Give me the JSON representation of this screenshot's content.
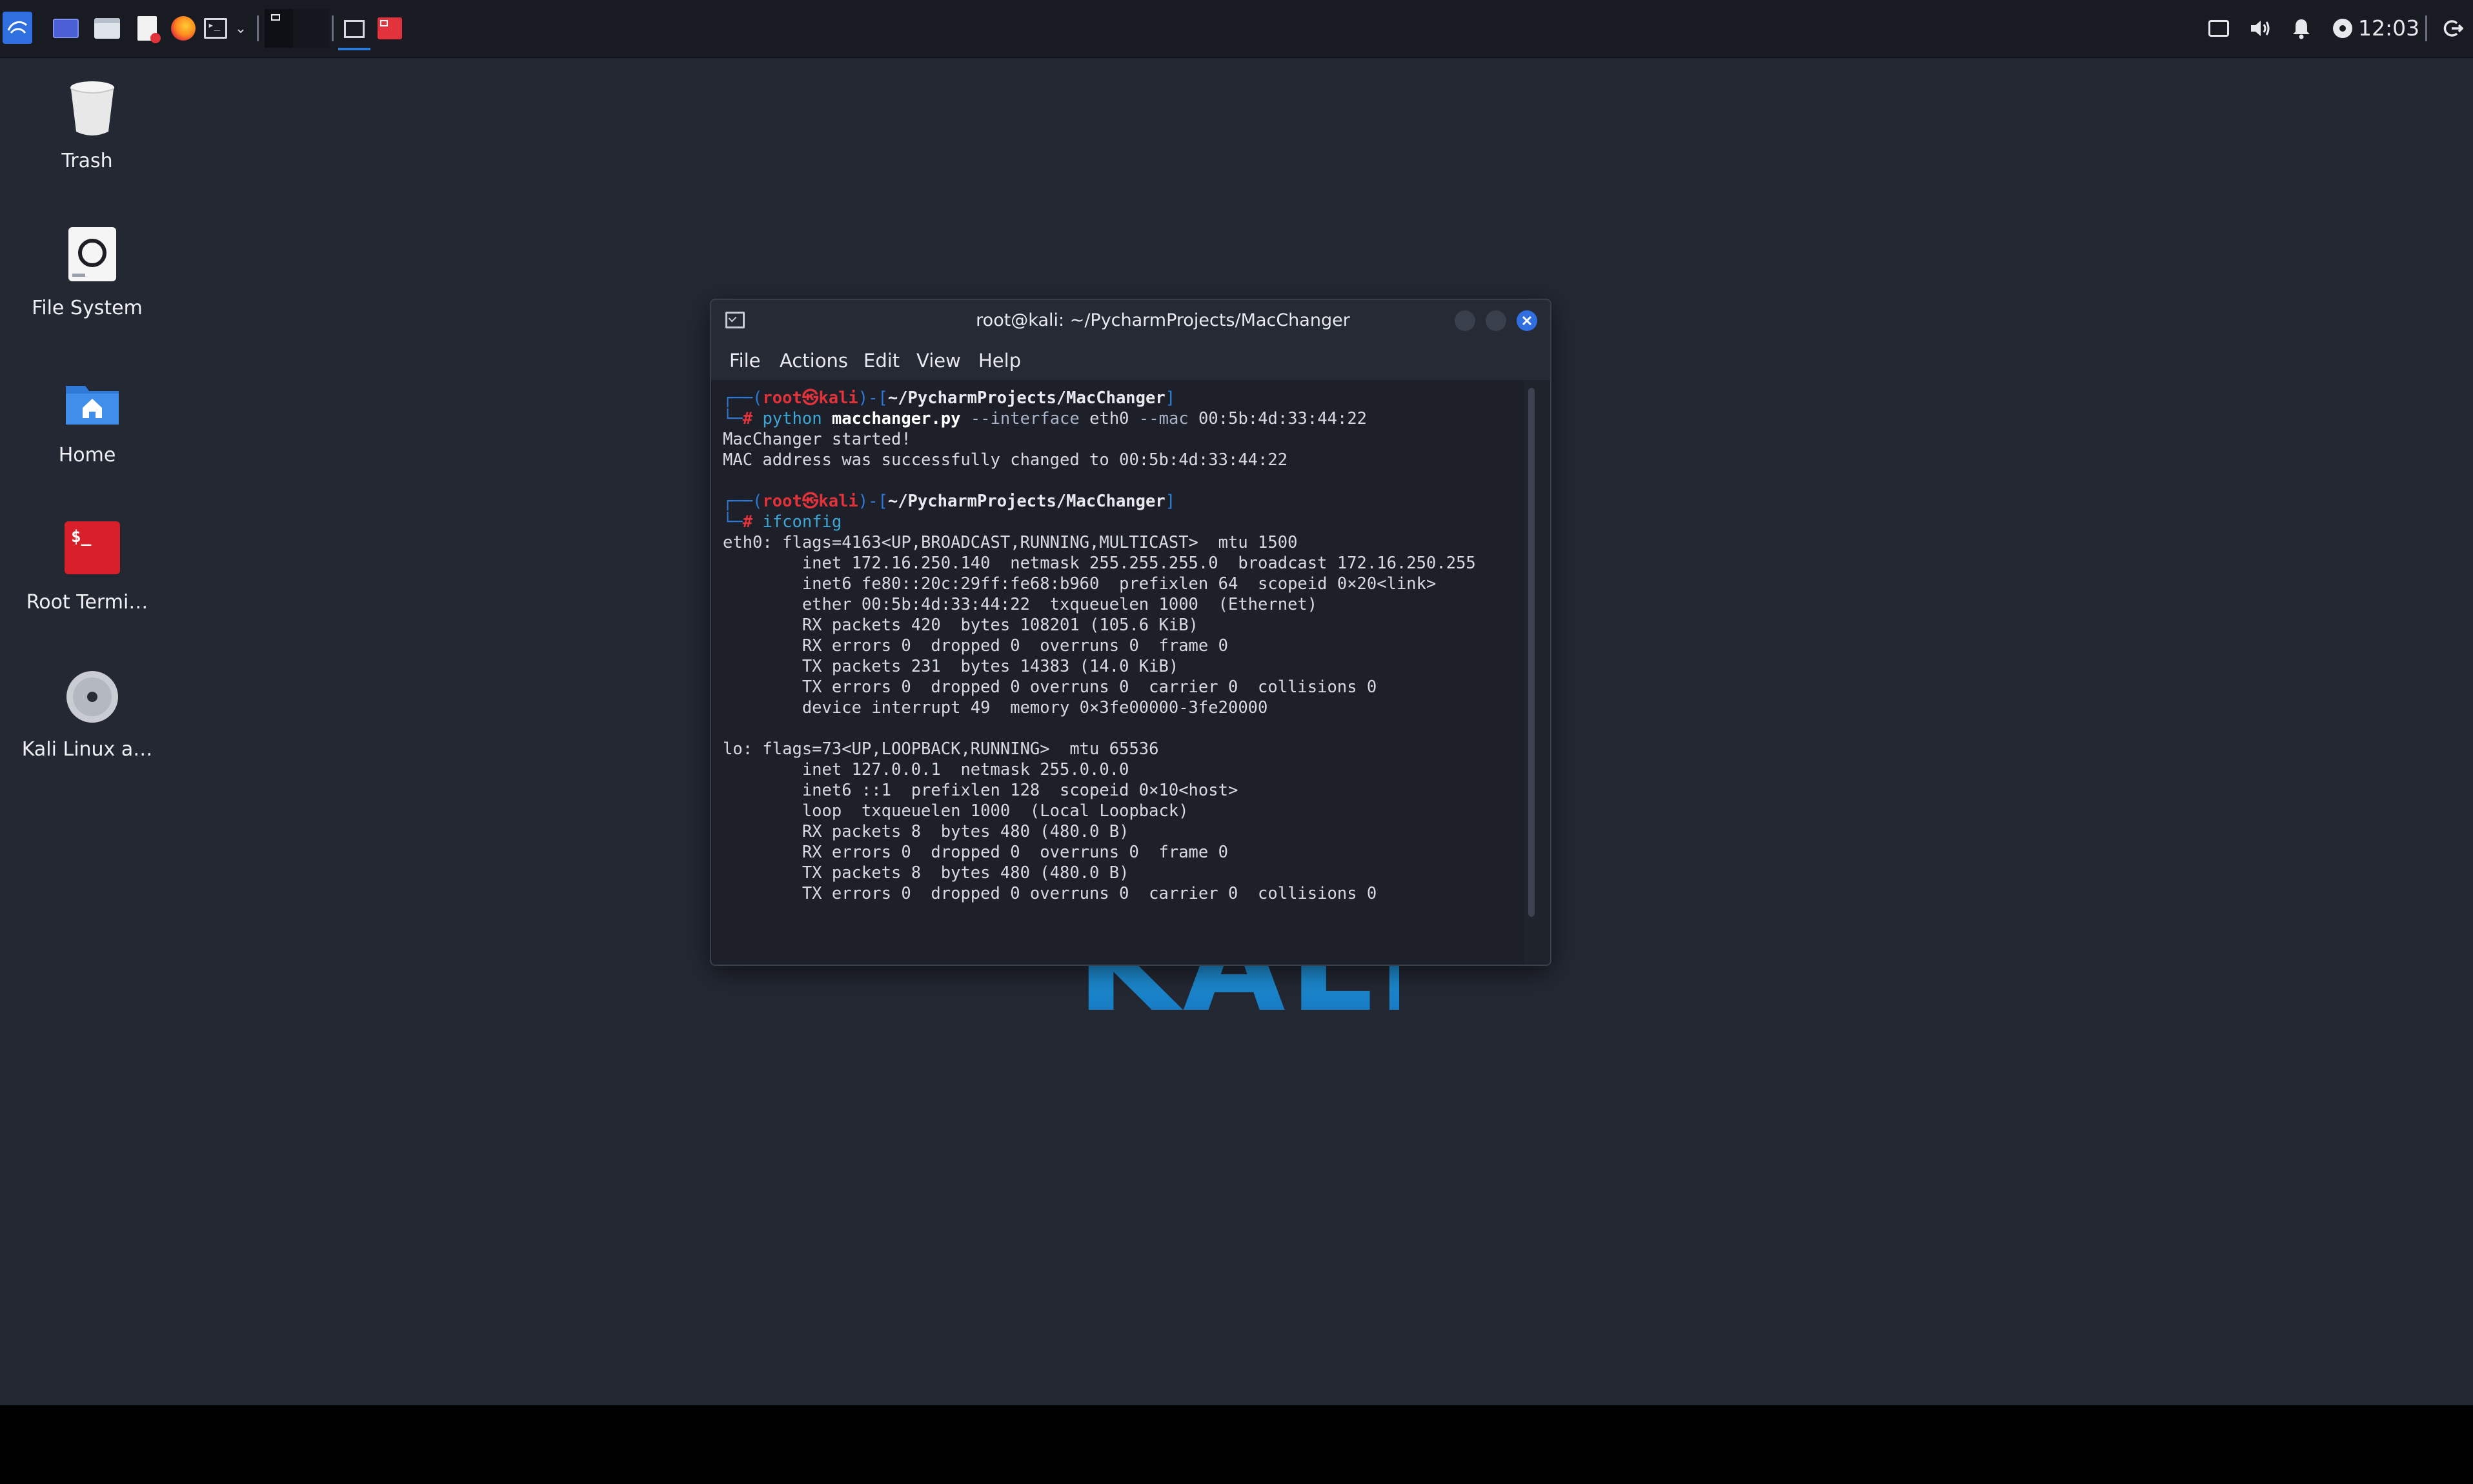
{
  "taskbar": {
    "clock": "12:03",
    "icons": [
      "kali-menu-icon",
      "workspace-icon",
      "file-manager-icon",
      "text-editor-icon",
      "firefox-icon",
      "terminal-icon",
      "dropdown-icon",
      "workspace-1-icon",
      "workspace-2-icon",
      "terminal-task-icon",
      "root-terminal-task-icon"
    ],
    "tray_icons": [
      "display-icon",
      "volume-icon",
      "notification-bell-icon",
      "power-status-icon",
      "logout-icon"
    ]
  },
  "desktop": {
    "icons": [
      {
        "label": "Trash",
        "icon": "trash-icon"
      },
      {
        "label": "File System",
        "icon": "drive-icon"
      },
      {
        "label": "Home",
        "icon": "home-folder-icon"
      },
      {
        "label": "Root Termi…",
        "icon": "root-terminal-icon"
      },
      {
        "label": "Kali Linux a…",
        "icon": "disc-icon"
      }
    ],
    "wallpaper_logo": "KALI"
  },
  "terminal": {
    "title": "root@kali: ~/PycharmProjects/MacChanger",
    "menu": [
      "File",
      "Actions",
      "Edit",
      "View",
      "Help"
    ],
    "prompt": {
      "user": "root",
      "at": "㉿",
      "host": "kali",
      "path": "~/PycharmProjects/MacChanger",
      "hash": "#"
    },
    "cmd1": {
      "program": "python",
      "script": "macchanger.py",
      "flag1": "--interface",
      "arg1": "eth0",
      "flag2": "--mac",
      "arg2": "00:5b:4d:33:44:22"
    },
    "out1": [
      "MacChanger started!",
      "MAC address was successfully changed to 00:5b:4d:33:44:22"
    ],
    "cmd2": "ifconfig",
    "out2": [
      "eth0: flags=4163<UP,BROADCAST,RUNNING,MULTICAST>  mtu 1500",
      "        inet 172.16.250.140  netmask 255.255.255.0  broadcast 172.16.250.255",
      "        inet6 fe80::20c:29ff:fe68:b960  prefixlen 64  scopeid 0×20<link>",
      "        ether 00:5b:4d:33:44:22  txqueuelen 1000  (Ethernet)",
      "        RX packets 420  bytes 108201 (105.6 KiB)",
      "        RX errors 0  dropped 0  overruns 0  frame 0",
      "        TX packets 231  bytes 14383 (14.0 KiB)",
      "        TX errors 0  dropped 0 overruns 0  carrier 0  collisions 0",
      "        device interrupt 49  memory 0×3fe00000-3fe20000",
      "",
      "lo: flags=73<UP,LOOPBACK,RUNNING>  mtu 65536",
      "        inet 127.0.0.1  netmask 255.0.0.0",
      "        inet6 ::1  prefixlen 128  scopeid 0×10<host>",
      "        loop  txqueuelen 1000  (Local Loopback)",
      "        RX packets 8  bytes 480 (480.0 B)",
      "        RX errors 0  dropped 0  overruns 0  frame 0",
      "        TX packets 8  bytes 480 (480.0 B)",
      "        TX errors 0  dropped 0 overruns 0  carrier 0  collisions 0"
    ]
  },
  "colors": {
    "desktop_bg": "#242833",
    "taskbar_bg": "#181b22",
    "prompt_red": "#e2323b",
    "prompt_frame_blue": "#2f7ad6",
    "command_blue": "#3fa7d6",
    "close_button_blue": "#2f6fe0",
    "kali_logo_blue": "#1f9fe0"
  }
}
